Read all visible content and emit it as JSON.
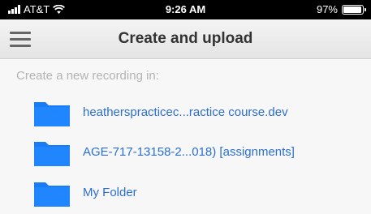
{
  "status_bar": {
    "carrier": "AT&T",
    "time": "9:26 AM",
    "battery_text": "97%",
    "battery_level": 0.97,
    "icons": [
      "signal-icon",
      "wifi-icon",
      "battery-icon"
    ]
  },
  "header": {
    "title": "Create and upload",
    "menu_icon": "hamburger-menu-icon"
  },
  "main": {
    "section_label": "Create a new recording in:",
    "folders": [
      {
        "label": "heatherspracticec...ractice course.dev",
        "icon": "folder-icon"
      },
      {
        "label": "AGE-717-13158-2...018) [assignments]",
        "icon": "folder-icon"
      },
      {
        "label": "My Folder",
        "icon": "folder-icon"
      }
    ]
  },
  "colors": {
    "status_bar_bg": "#000000",
    "link": "#2a6fd1",
    "folder": "#1a7cf5",
    "muted_text": "#b3b3b3"
  }
}
